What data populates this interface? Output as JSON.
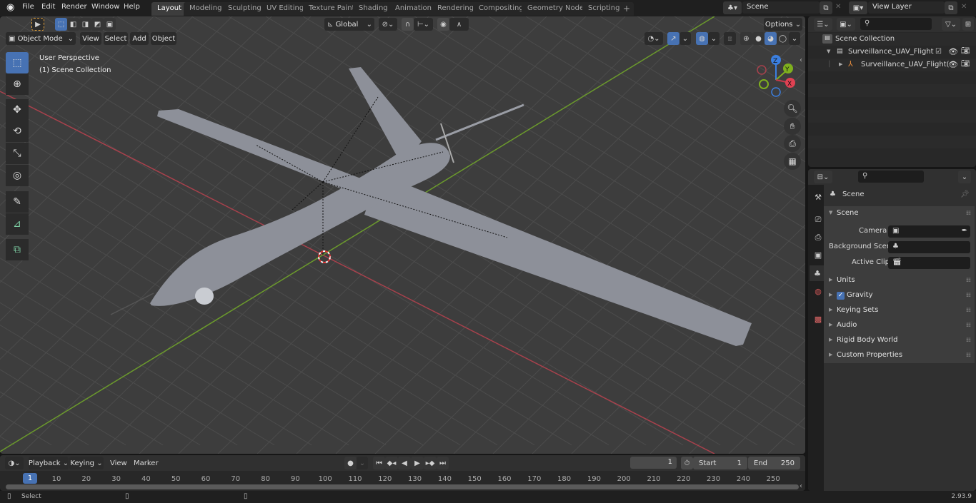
{
  "app": {
    "version": "2.93.9"
  },
  "topbar": {
    "menus": [
      "File",
      "Edit",
      "Render",
      "Window",
      "Help"
    ],
    "workspaces": [
      "Layout",
      "Modeling",
      "Sculpting",
      "UV Editing",
      "Texture Paint",
      "Shading",
      "Animation",
      "Rendering",
      "Compositing",
      "Geometry Nodes",
      "Scripting"
    ],
    "active_workspace": "Layout",
    "add_workspace": "+",
    "scene": "Scene",
    "view_layer": "View Layer"
  },
  "viewport": {
    "mode": "Object Mode",
    "menus": [
      "View",
      "Select",
      "Add",
      "Object"
    ],
    "orientation": "Global",
    "options": "Options",
    "overlay_text": {
      "line1": "User Perspective",
      "line2": "(1) Scene Collection"
    },
    "gizmo": {
      "x": "X",
      "y": "Y",
      "z": "Z"
    },
    "colors": {
      "x_axis": "#c8394a",
      "y_axis": "#7fb01e",
      "z_axis": "#3b7fe0",
      "accent": "#4772b3"
    },
    "tools": [
      "select-box",
      "cursor",
      "move",
      "rotate",
      "scale",
      "transform",
      "annotate",
      "measure",
      "add-cube"
    ],
    "object_name": "Surveillance_UAV_Flight"
  },
  "outliner": {
    "search_placeholder": "",
    "root": "Scene Collection",
    "items": [
      {
        "label": "Surveillance_UAV_Flight",
        "type": "collection",
        "checked": true
      },
      {
        "label": "Surveillance_UAV_Flight(",
        "type": "empty"
      }
    ]
  },
  "properties": {
    "search_placeholder": "",
    "context": "Scene",
    "panel": "Scene",
    "fields": [
      {
        "label": "Camera",
        "value": ""
      },
      {
        "label": "Background Scene",
        "value": ""
      },
      {
        "label": "Active Clip",
        "value": ""
      }
    ],
    "subpanels": [
      "Units",
      "Gravity",
      "Keying Sets",
      "Audio",
      "Rigid Body World",
      "Custom Properties"
    ],
    "gravity_checked": true
  },
  "timeline": {
    "menus": [
      "Playback",
      "Keying",
      "View",
      "Marker"
    ],
    "current_frame": "1",
    "start_label": "Start",
    "start": "1",
    "end_label": "End",
    "end": "250",
    "ticks": [
      "10",
      "20",
      "30",
      "40",
      "50",
      "60",
      "70",
      "80",
      "90",
      "100",
      "110",
      "120",
      "130",
      "140",
      "150",
      "160",
      "170",
      "180",
      "190",
      "200",
      "210",
      "220",
      "230",
      "240",
      "250"
    ],
    "playhead": "1"
  },
  "statusbar": {
    "left": "Select",
    "version": "2.93.9"
  }
}
